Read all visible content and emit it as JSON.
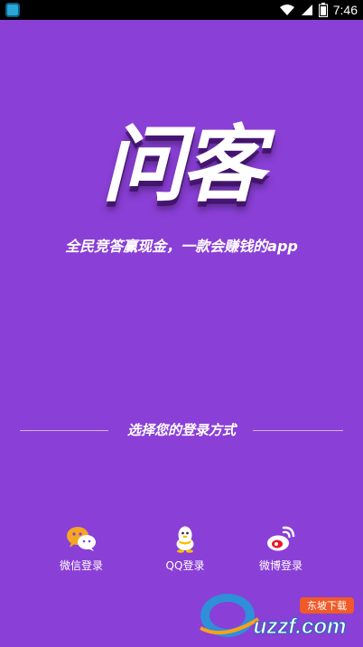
{
  "status_bar": {
    "time": "7:46",
    "icons": [
      "app-notification-icon",
      "wifi-icon",
      "signal-icon",
      "battery-icon"
    ]
  },
  "title": "问客",
  "slogan": "全民竞答赢现金，一款会赚钱的app",
  "login_prompt": "选择您的登录方式",
  "login_options": [
    {
      "label": "微信登录",
      "icon": "wechat-icon"
    },
    {
      "label": "QQ登录",
      "icon": "qq-icon"
    },
    {
      "label": "微博登录",
      "icon": "weibo-icon"
    }
  ],
  "watermark": {
    "text": "uzzf.com",
    "badge": "东坡下载"
  },
  "colors": {
    "background": "#8a3fd6",
    "status_bar": "#000000",
    "text": "#ffffff",
    "wechat": "#f5a623",
    "weibo_red": "#e6162d"
  }
}
